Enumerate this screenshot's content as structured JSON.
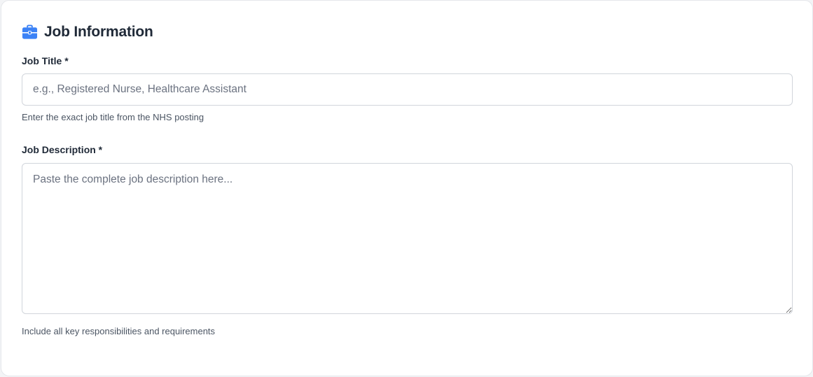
{
  "section": {
    "title": "Job Information",
    "icon": "briefcase-icon",
    "icon_color": "#3b82f6"
  },
  "job_title": {
    "label": "Job Title *",
    "placeholder": "e.g., Registered Nurse, Healthcare Assistant",
    "value": "",
    "hint": "Enter the exact job title from the NHS posting"
  },
  "job_description": {
    "label": "Job Description *",
    "placeholder": "Paste the complete job description here...",
    "value": "",
    "hint": "Include all key responsibilities and requirements"
  }
}
